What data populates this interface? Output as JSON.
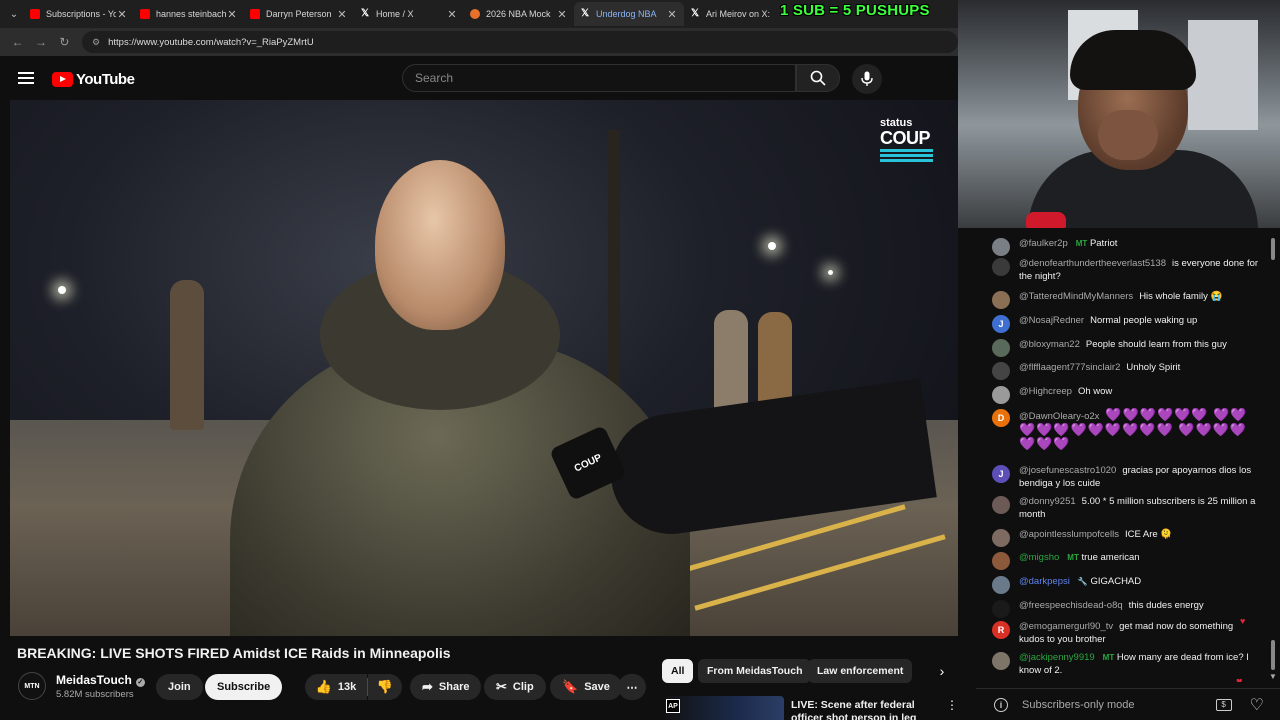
{
  "browser": {
    "tabs": [
      {
        "title": "Subscriptions - Yo",
        "favicon": "youtube-icon",
        "active": false
      },
      {
        "title": "hannes steinbach",
        "favicon": "youtube-icon",
        "active": false
      },
      {
        "title": "Darryn Peterson",
        "favicon": "youtube-icon",
        "active": false
      },
      {
        "title": "Home / X",
        "favicon": "x-icon",
        "active": false
      },
      {
        "title": "2026 NBA Mock",
        "favicon": "nba-icon",
        "active": false
      },
      {
        "title": "Underdog NBA",
        "favicon": "x-icon",
        "active": true
      },
      {
        "title": "Ari Meirov on X:",
        "favicon": "x-icon",
        "active": false
      }
    ],
    "url": "https://www.youtube.com/watch?v=_RiaPyZMrtU",
    "overlay_banner": "1 SUB = 5 PUSHUPS"
  },
  "youtube": {
    "logo_text": "YouTube",
    "search_placeholder": "Search"
  },
  "video": {
    "watermark_small": "status",
    "watermark_big": "COUP",
    "mic_flag": "COUP",
    "title": "BREAKING: LIVE SHOTS FIRED Amidst ICE Raids in Minneapolis",
    "channel": {
      "avatar_text": "MTN",
      "name": "MeidasTouch",
      "subscribers": "5.82M subscribers"
    },
    "actions": {
      "join": "Join",
      "subscribe": "Subscribe",
      "likes": "13k",
      "share": "Share",
      "clip": "Clip",
      "save": "Save"
    }
  },
  "sidebar": {
    "chips": [
      "All",
      "From MeidasTouch",
      "Law enforcement"
    ],
    "recommendation": {
      "badge": "AP",
      "title": "LIVE: Scene after federal officer shot person in leg after being"
    }
  },
  "chat": {
    "messages": [
      {
        "author": "@faulker2p",
        "badge": "MT",
        "text": "Patriot",
        "avatar_color": "#7a7f86",
        "avatar_letter": ""
      },
      {
        "author": "@denofearthundertheeverlast5138",
        "badge": "",
        "text": "is everyone done for the night?",
        "avatar_color": "#3a3a3a",
        "avatar_letter": ""
      },
      {
        "author": "@TatteredMindMyManners",
        "badge": "",
        "text": "His whole family 😭",
        "avatar_color": "#8a6f55",
        "avatar_letter": ""
      },
      {
        "author": "@NosajRedner",
        "badge": "",
        "text": "Normal people waking up",
        "avatar_color": "#3f6fd1",
        "avatar_letter": "J"
      },
      {
        "author": "@bloxyman22",
        "badge": "",
        "text": "People should learn from this guy",
        "avatar_color": "#5a6a5a",
        "avatar_letter": ""
      },
      {
        "author": "@flfflaagent777sinclair2",
        "badge": "",
        "text": "Unholy Spirit",
        "avatar_color": "#444",
        "avatar_letter": ""
      },
      {
        "author": "@Highcreep",
        "badge": "",
        "text": "Oh wow",
        "avatar_color": "#9a9a9a",
        "avatar_letter": ""
      },
      {
        "author": "@DawnOleary-o2x",
        "badge": "",
        "text": "💜💜💜💜💜💜 💜💜💜💜💜💜💜💜💜💜💜 💜💜💜💜💜💜💜",
        "avatar_color": "#e8710a",
        "avatar_letter": "D"
      },
      {
        "author": "@josefunescastro1020",
        "badge": "",
        "text": "gracias por apoyarnos dios los bendiga y los cuide",
        "avatar_color": "#5c4fb8",
        "avatar_letter": "J"
      },
      {
        "author": "@donny9251",
        "badge": "",
        "text": "5.00 * 5 million subscribers is 25 million a month",
        "avatar_color": "#6b5a55",
        "avatar_letter": ""
      },
      {
        "author": "@apointlesslumpofcells",
        "badge": "",
        "text": "ICE Are 🫠",
        "avatar_color": "#7d6a60",
        "avatar_letter": ""
      },
      {
        "author": "@migsho",
        "badge": "MT",
        "text": "true american",
        "avatar_color": "#8c5a3a",
        "avatar_letter": ""
      },
      {
        "author": "@darkpepsi",
        "badge": "🔧",
        "text": "GIGACHAD",
        "avatar_color": "#6a7a8a",
        "avatar_letter": ""
      },
      {
        "author": "@freespeechisdead-o8q",
        "badge": "",
        "text": "this dudes energy",
        "avatar_color": "#1a1a1a",
        "avatar_letter": ""
      },
      {
        "author": "@emogamergurl90_tv",
        "badge": "",
        "text": "get mad now do something kudos to you brother",
        "avatar_color": "#d93025",
        "avatar_letter": "R"
      },
      {
        "author": "@jackipenny9919",
        "badge": "MT",
        "text": "How many are dead from ice? I know of 2.",
        "avatar_color": "#7c7568",
        "avatar_letter": ""
      }
    ],
    "footer_text": "Subscribers-only mode"
  }
}
